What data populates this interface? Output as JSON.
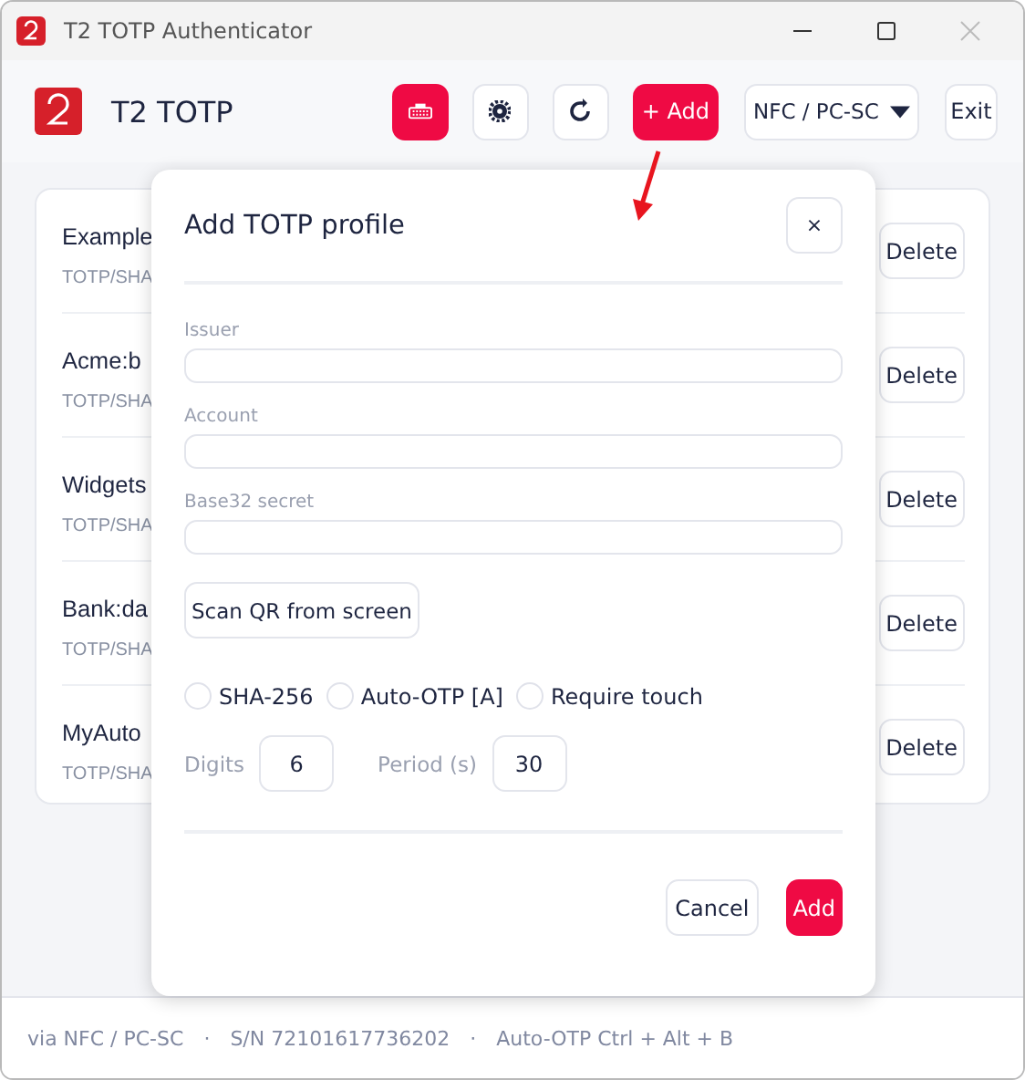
{
  "window": {
    "title": "T2 TOTP Authenticator"
  },
  "toolbar": {
    "app_name": "T2 TOTP",
    "add_label": "+ Add",
    "transport": "NFC / PC-SC",
    "exit_label": "Exit"
  },
  "profiles": [
    {
      "name": "Example",
      "detail": "TOTP/SHA",
      "action": "Delete"
    },
    {
      "name": "Acme:b",
      "detail": "TOTP/SHA",
      "action": "Delete"
    },
    {
      "name": "Widgets",
      "detail": "TOTP/SHA",
      "action": "Delete"
    },
    {
      "name": "Bank:da",
      "detail": "TOTP/SHA",
      "action": "Delete"
    },
    {
      "name": "MyAuto",
      "detail": "TOTP/SHA",
      "action": "Delete"
    }
  ],
  "dialog": {
    "title": "Add TOTP profile",
    "close": "×",
    "fields": [
      {
        "label": "Issuer"
      },
      {
        "label": "Account"
      },
      {
        "label": "Base32 secret"
      }
    ],
    "scan_button": "Scan QR from screen",
    "options": [
      {
        "label": "SHA-256",
        "checked": false
      },
      {
        "label": "Auto-OTP [A]",
        "checked": false
      },
      {
        "label": "Require touch",
        "checked": false
      }
    ],
    "digits": {
      "label": "Digits",
      "value": "6"
    },
    "period": {
      "label": "Period (s)",
      "value": "30"
    },
    "cancel": "Cancel",
    "confirm": "Add"
  },
  "status_bar": [
    "via NFC / PC-SC",
    "·",
    "S/N 72101617736202",
    "·",
    "Auto-OTP Ctrl + Alt + B"
  ]
}
